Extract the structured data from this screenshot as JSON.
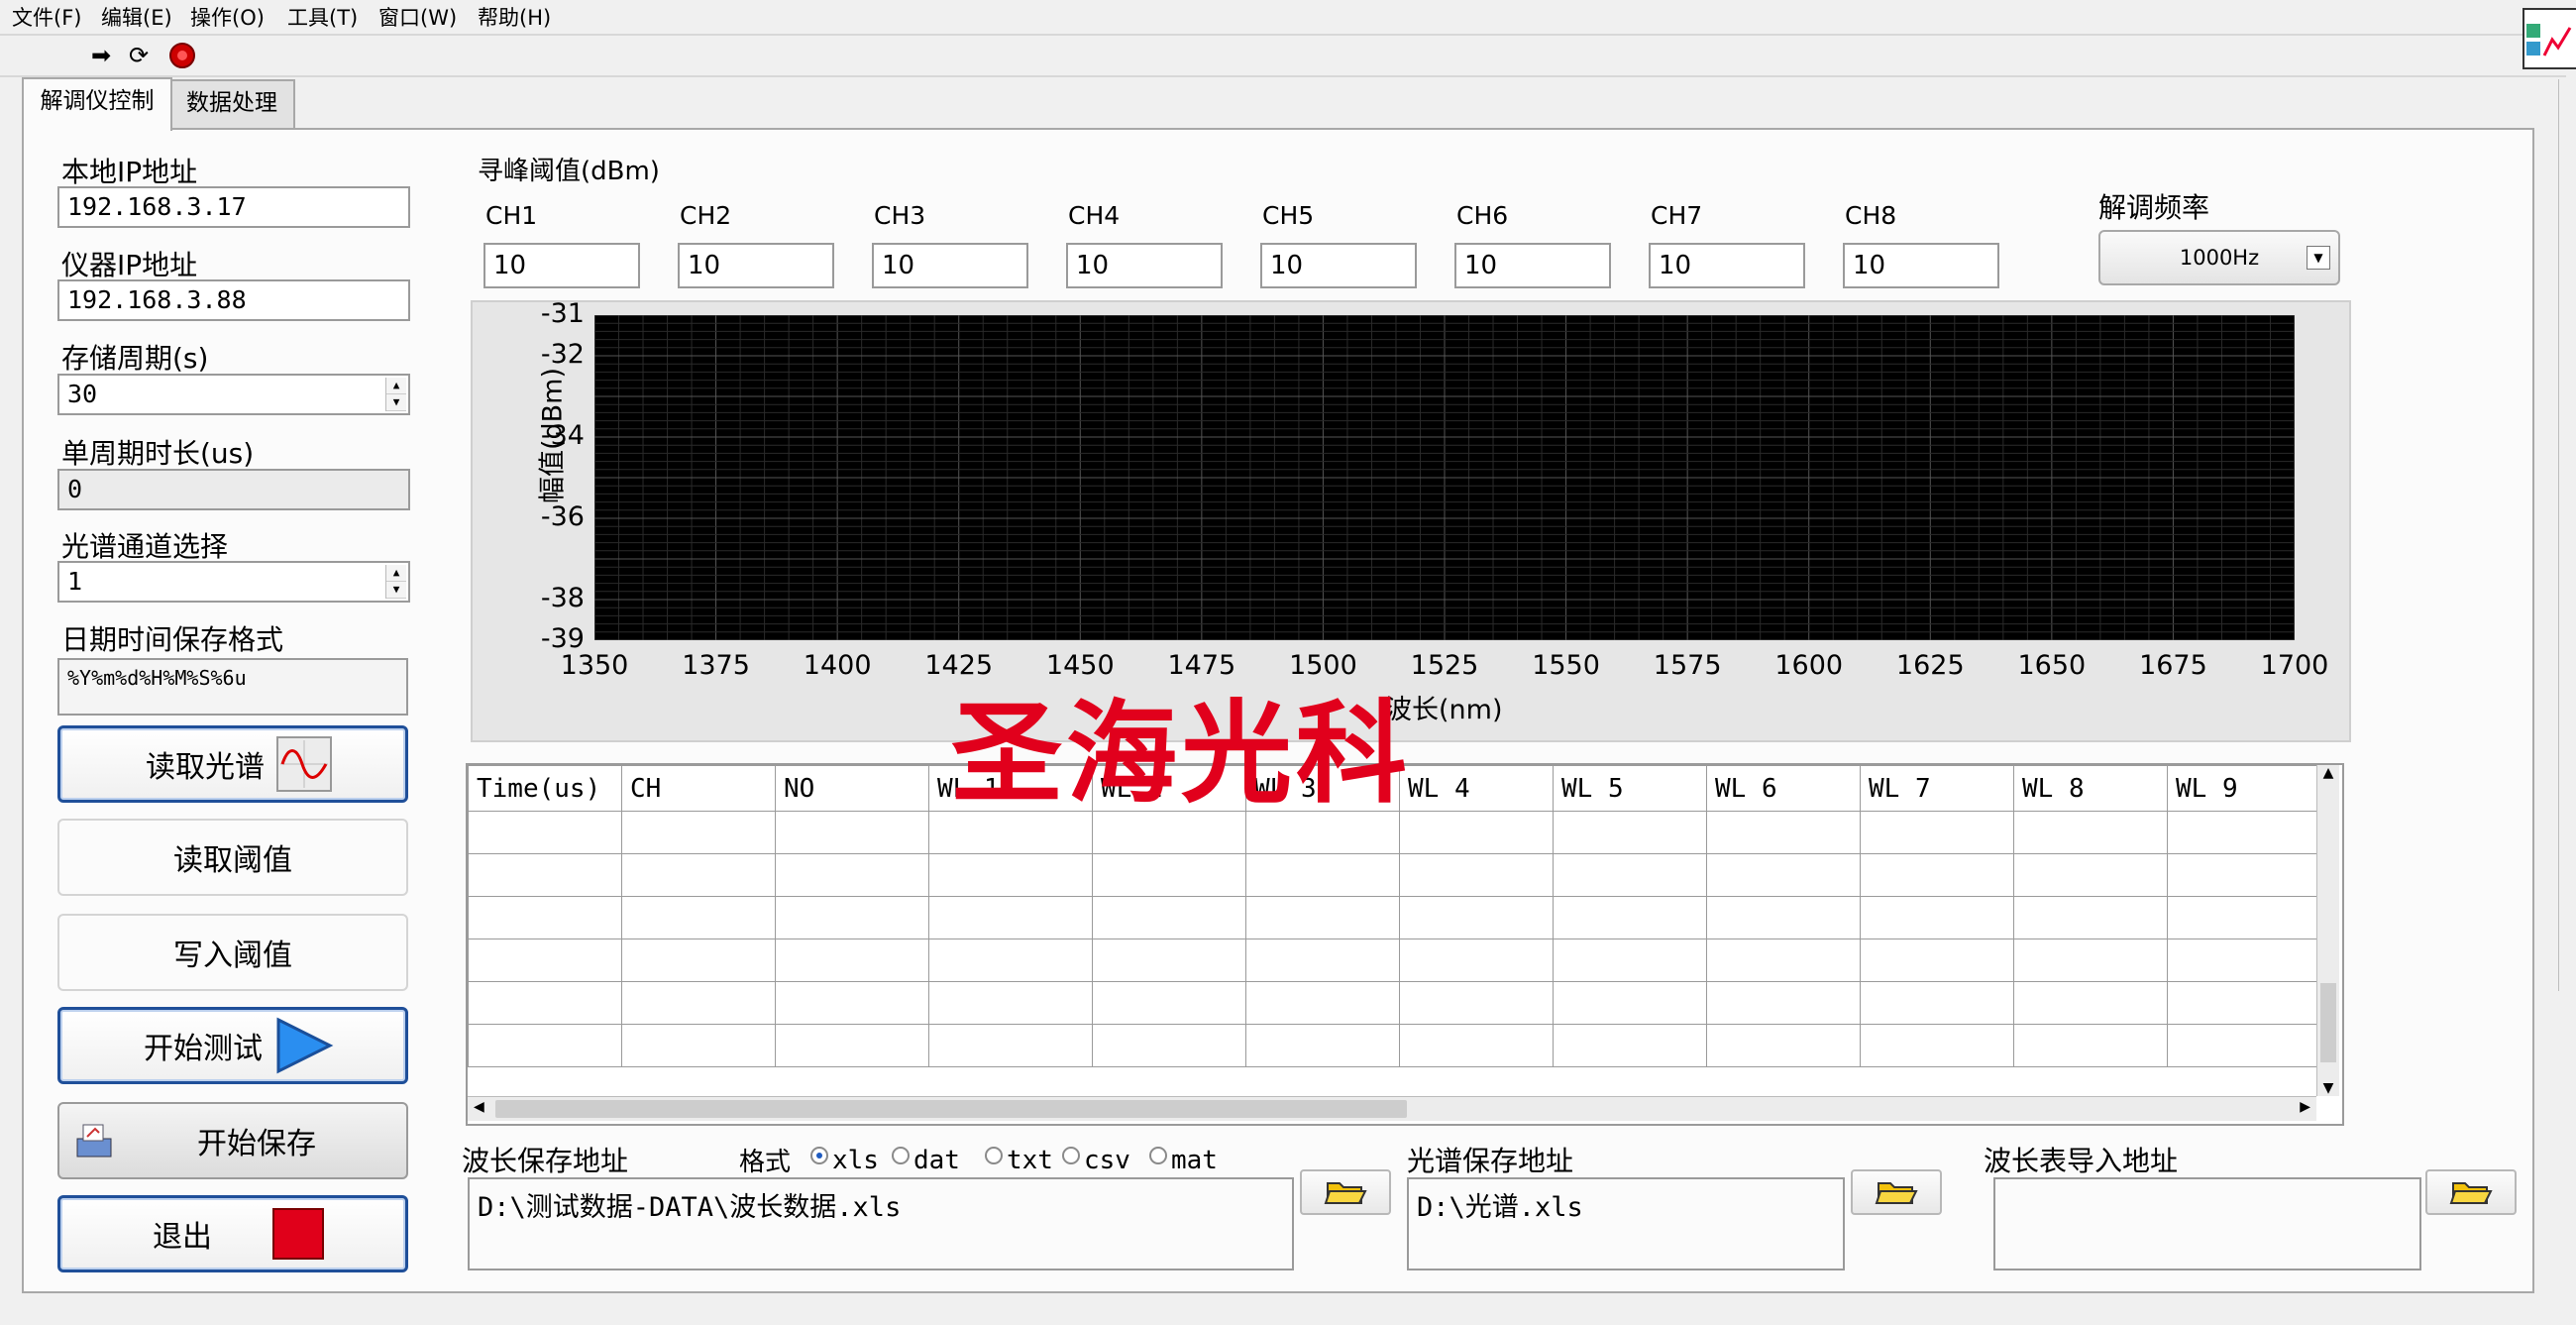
{
  "menu": [
    "文件(F)",
    "编辑(E)",
    "操作(O)",
    "工具(T)",
    "窗口(W)",
    "帮助(H)"
  ],
  "toolbar": {
    "icons": [
      "run-arrow-icon",
      "run-continuous-icon",
      "abort-stop-icon"
    ]
  },
  "tabs": [
    {
      "label": "解调仪控制",
      "active": true
    },
    {
      "label": "数据处理",
      "active": false
    }
  ],
  "left": {
    "local_ip_label": "本地IP地址",
    "local_ip": "192.168.3.17",
    "device_ip_label": "仪器IP地址",
    "device_ip": "192.168.3.88",
    "store_period_label": "存储周期(s)",
    "store_period": "30",
    "cycle_time_label": "单周期时长(us)",
    "cycle_time": "0",
    "channel_select_label": "光谱通道选择",
    "channel_select": "1",
    "datetime_format_label": "日期时间保存格式",
    "datetime_format": "%Y%m%d%H%M%S%6u"
  },
  "buttons": {
    "read_spectrum": "读取光谱",
    "read_threshold": "读取阈值",
    "write_threshold": "写入阈值",
    "start_test": "开始测试",
    "start_save": "开始保存",
    "exit": "退出"
  },
  "threshold": {
    "title": "寻峰阈值(dBm)",
    "channels": [
      {
        "label": "CH1",
        "value": "10"
      },
      {
        "label": "CH2",
        "value": "10"
      },
      {
        "label": "CH3",
        "value": "10"
      },
      {
        "label": "CH4",
        "value": "10"
      },
      {
        "label": "CH5",
        "value": "10"
      },
      {
        "label": "CH6",
        "value": "10"
      },
      {
        "label": "CH7",
        "value": "10"
      },
      {
        "label": "CH8",
        "value": "10"
      }
    ]
  },
  "demod_rate": {
    "label": "解调频率",
    "value": "1000Hz"
  },
  "watermark": "圣海光科",
  "chart_data": {
    "type": "line",
    "xlabel": "波长(nm)",
    "ylabel": "幅值(dBm)",
    "xlim": [
      1350,
      1700
    ],
    "ylim": [
      -39,
      -31
    ],
    "xticks": [
      "1350",
      "1375",
      "1400",
      "1425",
      "1450",
      "1475",
      "1500",
      "1525",
      "1550",
      "1575",
      "1600",
      "1625",
      "1650",
      "1675",
      "1700"
    ],
    "yticks": [
      "-31",
      "-32",
      "-34",
      "-36",
      "-38",
      "-39"
    ],
    "grid": true,
    "series": []
  },
  "table": {
    "columns": [
      "Time(us)",
      "CH",
      "NO",
      "WL 1",
      "WL 2",
      "WL 3",
      "WL 4",
      "WL 5",
      "WL 6",
      "WL 7",
      "WL 8",
      "WL 9"
    ],
    "empty_rows": 6
  },
  "bottom": {
    "wl_save_label": "波长保存地址",
    "format_label": "格式",
    "formats": [
      {
        "label": "xls",
        "selected": true
      },
      {
        "label": "dat",
        "selected": false
      },
      {
        "label": "txt",
        "selected": false
      },
      {
        "label": "csv",
        "selected": false
      },
      {
        "label": "mat",
        "selected": false
      }
    ],
    "wl_save_path": "D:\\测试数据-DATA\\波长数据.xls",
    "spectrum_save_label": "光谱保存地址",
    "spectrum_save_path": "D:\\光谱.xls",
    "wl_table_import_label": "波长表导入地址",
    "wl_table_import_path": ""
  },
  "colors": {
    "accent_blue": "#1f4f99",
    "stop_red": "#e0001a",
    "watermark_red": "#e1001c",
    "plot_bg": "#000000",
    "grid": "#3a3a3a"
  }
}
